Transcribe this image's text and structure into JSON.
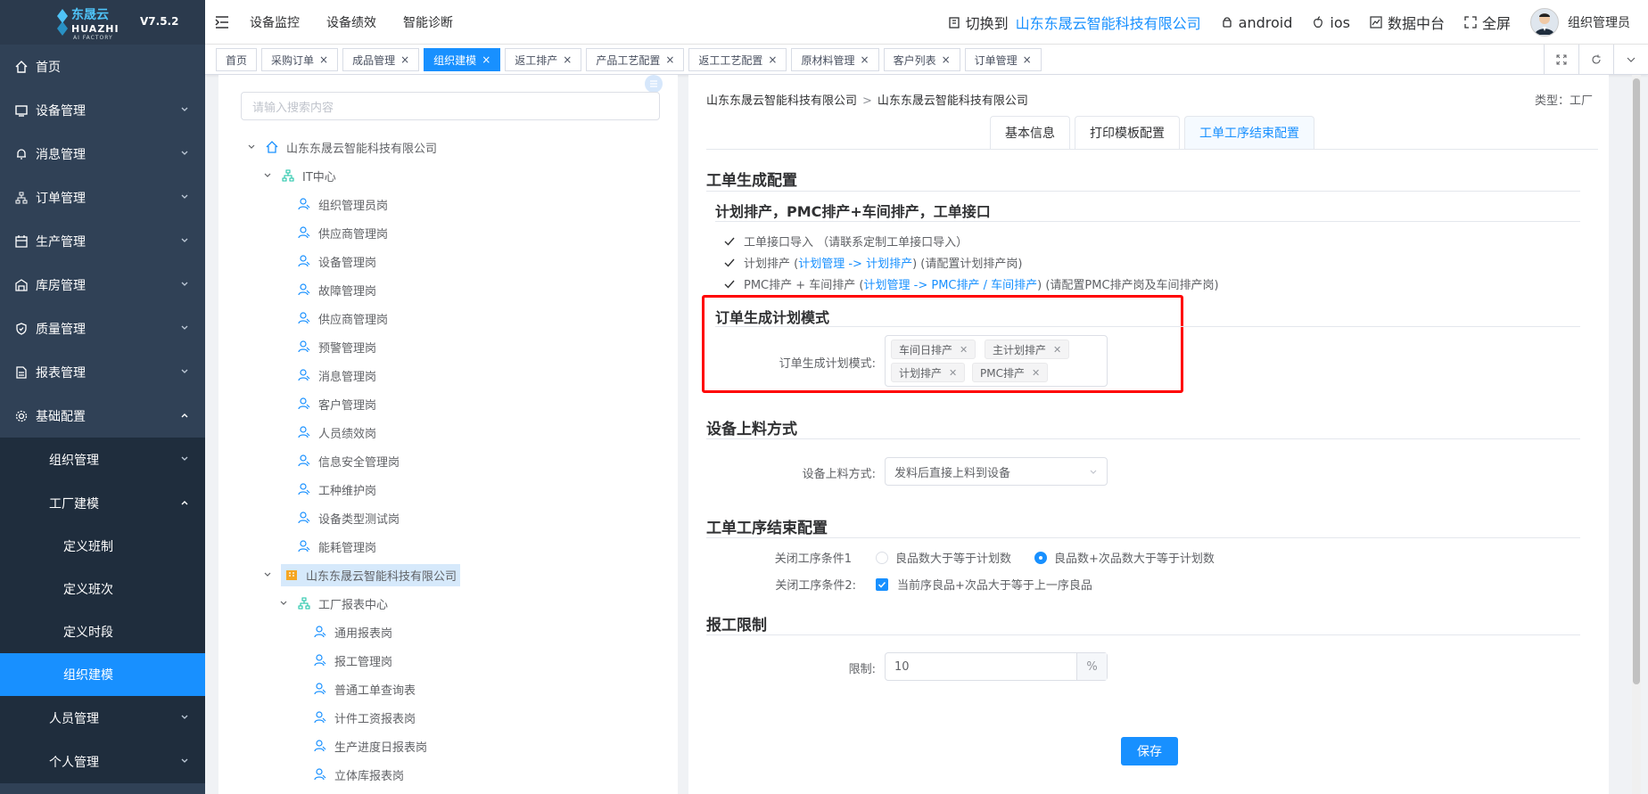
{
  "brand": {
    "name_cn": "东晟云",
    "name_en": "HUAZHI",
    "tagline": "AI FACTORY",
    "version": "V7.5.2"
  },
  "sidebar": {
    "items": [
      {
        "label": "首页"
      },
      {
        "label": "设备管理"
      },
      {
        "label": "消息管理"
      },
      {
        "label": "订单管理"
      },
      {
        "label": "生产管理"
      },
      {
        "label": "库房管理"
      },
      {
        "label": "质量管理"
      },
      {
        "label": "报表管理"
      },
      {
        "label": "基础配置"
      }
    ],
    "sub": {
      "org": "组织管理",
      "factory": "工厂建模",
      "factory_children": [
        "定义班制",
        "定义班次",
        "定义时段",
        "组织建模"
      ],
      "people": "人员管理",
      "personal": "个人管理"
    }
  },
  "header": {
    "nav": [
      "设备监控",
      "设备绩效",
      "智能诊断"
    ],
    "switch_label": "切换到",
    "company": "山东东晟云智能科技有限公司",
    "android": "android",
    "ios": "ios",
    "data_center": "数据中台",
    "fullscreen": "全屏",
    "user": "组织管理员"
  },
  "tabs": [
    {
      "label": "首页",
      "closable": false
    },
    {
      "label": "采购订单",
      "closable": true
    },
    {
      "label": "成品管理",
      "closable": true
    },
    {
      "label": "组织建模",
      "closable": true,
      "active": true
    },
    {
      "label": "返工排产",
      "closable": true
    },
    {
      "label": "产品工艺配置",
      "closable": true
    },
    {
      "label": "返工工艺配置",
      "closable": true
    },
    {
      "label": "原材料管理",
      "closable": true
    },
    {
      "label": "客户列表",
      "closable": true
    },
    {
      "label": "订单管理",
      "closable": true
    }
  ],
  "tree": {
    "search_placeholder": "请输入搜索内容",
    "root": "山东东晟云智能科技有限公司",
    "it_center": "IT中心",
    "it_children": [
      "组织管理员岗",
      "供应商管理岗",
      "设备管理岗",
      "故障管理岗",
      "供应商管理岗",
      "预警管理岗",
      "消息管理岗",
      "客户管理岗",
      "人员绩效岗",
      "信息安全管理岗",
      "工种维护岗",
      "设备类型测试岗",
      "能耗管理岗"
    ],
    "factory": "山东东晟云智能科技有限公司",
    "report_center": "工厂报表中心",
    "report_children": [
      "通用报表岗",
      "报工管理岗",
      "普通工单查询表",
      "计件工资报表岗",
      "生产进度日报表岗",
      "立体库报表岗"
    ]
  },
  "config": {
    "breadcrumb": [
      "山东东晟云智能科技有限公司",
      "山东东晟云智能科技有限公司"
    ],
    "type_label": "类型：工厂",
    "tabs": [
      "基本信息",
      "打印模板配置",
      "工单工序结束配置"
    ],
    "work_order": {
      "title": "工单生成配置",
      "subtitle": "计划排产，PMC排产+车间排产，工单接口",
      "item1": "工单接口导入 （请联系定制工单接口导入）",
      "item2_pre": "计划排产 (",
      "item2_link": "计划管理 -> 计划排产",
      "item2_post": ") (请配置计划排产岗)",
      "item3_pre": "PMC排产 + 车间排产 (",
      "item3_link": "计划管理 -> PMC排产 / 车间排产",
      "item3_post": ") (请配置PMC排产岗及车间排产岗)"
    },
    "plan_mode": {
      "title": "订单生成计划模式",
      "label": "订单生成计划模式:",
      "tags": [
        "车间日排产",
        "主计划排产",
        "计划排产",
        "PMC排产"
      ]
    },
    "feeding": {
      "title": "设备上料方式",
      "label": "设备上料方式:",
      "value": "发料后直接上料到设备"
    },
    "close": {
      "title": "工单工序结束配置",
      "cond1_label": "关闭工序条件1",
      "cond1_opt1": "良品数大于等于计划数",
      "cond1_opt2": "良品数+次品数大于等于计划数",
      "cond2_label": "关闭工序条件2:",
      "cond2_opt": "当前序良品+次品大于等于上一序良品"
    },
    "report_limit": {
      "title": "报工限制",
      "label": "限制:",
      "value": "10",
      "unit": "%"
    },
    "save": "保存"
  },
  "colors": {
    "primary": "#1890ff",
    "sidebar": "#304156",
    "highlight": "#ff0000"
  }
}
